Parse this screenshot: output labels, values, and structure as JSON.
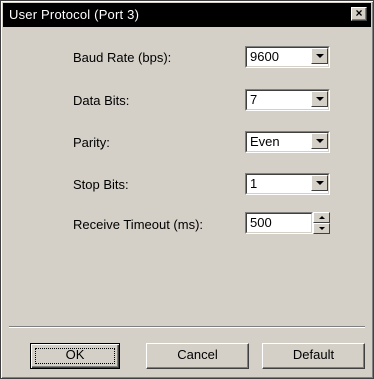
{
  "window": {
    "title": "User Protocol (Port 3)",
    "close_glyph": "×"
  },
  "fields": {
    "baud_rate": {
      "label": "Baud Rate (bps):",
      "value": "9600"
    },
    "data_bits": {
      "label": "Data Bits:",
      "value": "7"
    },
    "parity": {
      "label": "Parity:",
      "value": "Even"
    },
    "stop_bits": {
      "label": "Stop Bits:",
      "value": "1"
    },
    "receive_timeout": {
      "label": "Receive Timeout (ms):",
      "value": "500"
    }
  },
  "buttons": {
    "ok": "OK",
    "cancel": "Cancel",
    "default": "Default"
  },
  "icons": {
    "close": "close-icon",
    "dropdown": "chevron-down-icon",
    "spin_up": "spin-up-icon",
    "spin_down": "spin-down-icon"
  },
  "colors": {
    "face": "#d4d0c8",
    "titlebar": "#000000",
    "title_text": "#ffffff"
  }
}
